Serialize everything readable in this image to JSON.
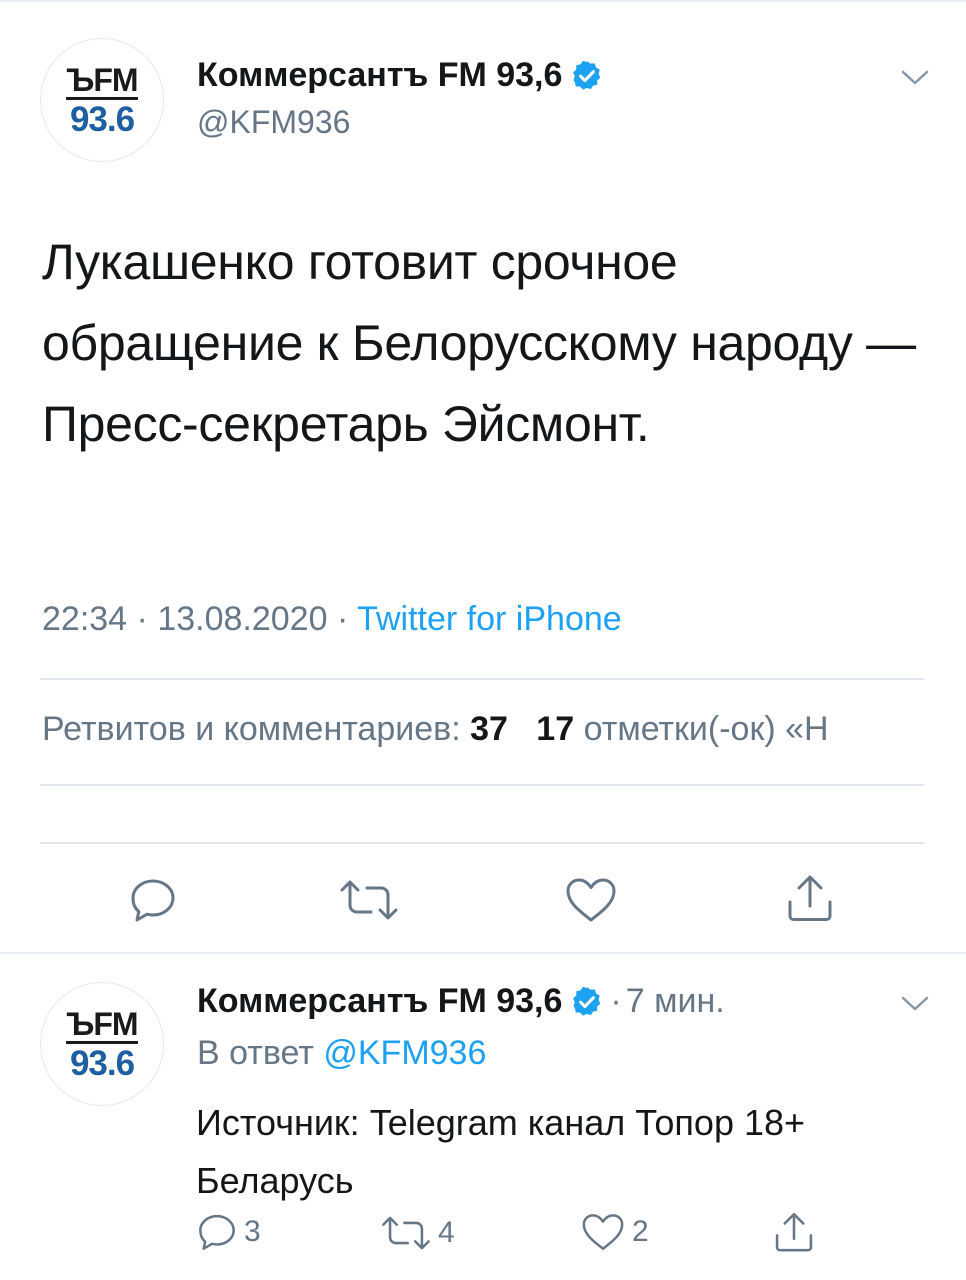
{
  "tweet": {
    "avatar": {
      "line1": "ЪFM",
      "line2": "93.6"
    },
    "name": "Коммерсантъ FM 93,6",
    "handle": "@KFM936",
    "text": "Лукашенко готовит срочное обращение к Белорусскому народу — Пресс-секретарь Эйсмонт.",
    "time": "22:34",
    "date": "13.08.2020",
    "source": "Twitter for iPhone",
    "stats": {
      "retweets_label": "Ретвитов и комментариев:",
      "retweets_count": "37",
      "likes_count": "17",
      "likes_label": "отметки(-ок) «Н"
    }
  },
  "reply": {
    "avatar": {
      "line1": "ЪFM",
      "line2": "93.6"
    },
    "name": "Коммерсантъ FM 93,6",
    "time_ago": "7 мин.",
    "reply_prefix": "В ответ",
    "reply_to": "@KFM936",
    "text": "Источник: Telegram канал Топор 18+ Беларусь",
    "counts": {
      "replies": "3",
      "retweets": "4",
      "likes": "2"
    }
  },
  "colors": {
    "accent": "#1da1f2",
    "muted": "#657786",
    "text": "#14171a"
  }
}
